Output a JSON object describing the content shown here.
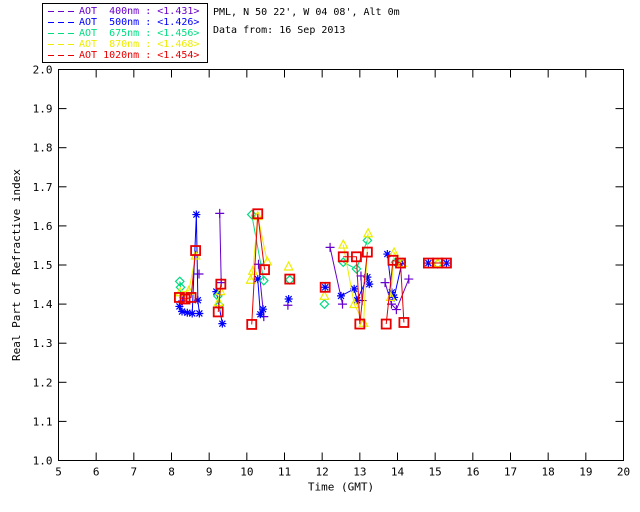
{
  "header": {
    "site_line": "PML, N 50 22', W 04 08', Alt 0m",
    "date_line": "Data from: 16 Sep 2013"
  },
  "legend": {
    "entries": [
      {
        "text": "AOT  400nm : <1.431>",
        "color": "#6600CC"
      },
      {
        "text": "AOT  500nm : <1.426>",
        "color": "#0000FF"
      },
      {
        "text": "AOT  675nm : <1.456>",
        "color": "#00DC82"
      },
      {
        "text": "AOT  870nm : <1.468>",
        "color": "#EDED00"
      },
      {
        "text": "AOT 1020nm : <1.454>",
        "color": "#E80000"
      }
    ]
  },
  "chart_data": {
    "type": "scatter",
    "title": "",
    "xlabel": "Time (GMT)",
    "ylabel": "Real Part of Refractive index",
    "xlim": [
      5,
      20
    ],
    "ylim": [
      1.0,
      2.0
    ],
    "xticks": [
      "5",
      "6",
      "7",
      "8",
      "9",
      "10",
      "11",
      "12",
      "13",
      "14",
      "15",
      "16",
      "17",
      "18",
      "19",
      "20"
    ],
    "yticks": [
      "1.0",
      "1.1",
      "1.2",
      "1.3",
      "1.4",
      "1.5",
      "1.6",
      "1.7",
      "1.8",
      "1.9",
      "2.0"
    ],
    "grid": false,
    "legend_position": "top-left-outside",
    "line_break_gap_hours": 0.35,
    "series": [
      {
        "name": "AOT 400nm",
        "mean_value": "<1.431>",
        "color": "#6600CC",
        "marker": "plus",
        "points": [
          [
            8.29,
            1.408
          ],
          [
            8.73,
            1.477
          ],
          [
            9.28,
            1.632
          ],
          [
            9.32,
            1.455
          ],
          [
            10.31,
            1.502
          ],
          [
            10.45,
            1.368
          ],
          [
            11.09,
            1.397
          ],
          [
            12.21,
            1.545
          ],
          [
            12.54,
            1.4
          ],
          [
            13.03,
            1.472
          ],
          [
            13.06,
            1.409
          ],
          [
            13.67,
            1.455
          ],
          [
            13.84,
            1.4
          ],
          [
            13.97,
            1.386
          ],
          [
            14.3,
            1.464
          ]
        ]
      },
      {
        "name": "AOT 500nm",
        "mean_value": "<1.426>",
        "color": "#0000FF",
        "marker": "asterisk",
        "points": [
          [
            8.21,
            1.394
          ],
          [
            8.28,
            1.381
          ],
          [
            8.42,
            1.378
          ],
          [
            8.55,
            1.376
          ],
          [
            8.66,
            1.629
          ],
          [
            8.7,
            1.41
          ],
          [
            8.74,
            1.376
          ],
          [
            9.19,
            1.432
          ],
          [
            9.35,
            1.35
          ],
          [
            10.29,
            1.464
          ],
          [
            10.36,
            1.374
          ],
          [
            10.43,
            1.387
          ],
          [
            11.11,
            1.413
          ],
          [
            12.08,
            1.443
          ],
          [
            12.5,
            1.421
          ],
          [
            12.85,
            1.439
          ],
          [
            12.93,
            1.41
          ],
          [
            13.2,
            1.469
          ],
          [
            13.25,
            1.451
          ],
          [
            13.73,
            1.528
          ],
          [
            13.85,
            1.43
          ],
          [
            13.91,
            1.417
          ],
          [
            14.12,
            1.507
          ],
          [
            14.82,
            1.505
          ],
          [
            15.3,
            1.505
          ]
        ]
      },
      {
        "name": "AOT 675nm",
        "mean_value": "<1.456>",
        "color": "#00DC82",
        "marker": "diamond",
        "points": [
          [
            8.22,
            1.458
          ],
          [
            8.24,
            1.443
          ],
          [
            9.23,
            1.421
          ],
          [
            9.27,
            1.397
          ],
          [
            10.13,
            1.629
          ],
          [
            10.45,
            1.46
          ],
          [
            11.14,
            1.462
          ],
          [
            12.06,
            1.4
          ],
          [
            12.56,
            1.507
          ],
          [
            12.91,
            1.49
          ],
          [
            13.2,
            1.563
          ],
          [
            13.95,
            1.507
          ],
          [
            15.07,
            1.503
          ]
        ]
      },
      {
        "name": "AOT 870nm",
        "mean_value": "<1.468>",
        "color": "#EDED00",
        "marker": "triangle",
        "points": [
          [
            8.23,
            1.43
          ],
          [
            8.46,
            1.434
          ],
          [
            8.64,
            1.524
          ],
          [
            9.25,
            1.405
          ],
          [
            9.3,
            1.433
          ],
          [
            10.1,
            1.462
          ],
          [
            10.16,
            1.485
          ],
          [
            10.29,
            1.625
          ],
          [
            10.54,
            1.509
          ],
          [
            11.11,
            1.496
          ],
          [
            12.06,
            1.421
          ],
          [
            12.56,
            1.552
          ],
          [
            12.85,
            1.4
          ],
          [
            13.1,
            1.352
          ],
          [
            13.22,
            1.581
          ],
          [
            13.82,
            1.418
          ],
          [
            13.91,
            1.532
          ],
          [
            14.12,
            1.505
          ],
          [
            15.07,
            1.505
          ]
        ]
      },
      {
        "name": "AOT 1020nm",
        "mean_value": "<1.454>",
        "color": "#E80000",
        "marker": "square",
        "points": [
          [
            8.21,
            1.417
          ],
          [
            8.36,
            1.413
          ],
          [
            8.52,
            1.417
          ],
          [
            8.64,
            1.537
          ],
          [
            9.24,
            1.38
          ],
          [
            9.31,
            1.451
          ],
          [
            10.13,
            1.348
          ],
          [
            10.29,
            1.631
          ],
          [
            10.47,
            1.488
          ],
          [
            11.14,
            1.464
          ],
          [
            12.08,
            1.443
          ],
          [
            12.56,
            1.521
          ],
          [
            12.91,
            1.521
          ],
          [
            13.0,
            1.349
          ],
          [
            13.2,
            1.533
          ],
          [
            13.7,
            1.349
          ],
          [
            13.88,
            1.512
          ],
          [
            14.08,
            1.505
          ],
          [
            14.17,
            1.353
          ],
          [
            14.82,
            1.505
          ],
          [
            15.07,
            1.505
          ],
          [
            15.3,
            1.505
          ]
        ]
      }
    ]
  }
}
